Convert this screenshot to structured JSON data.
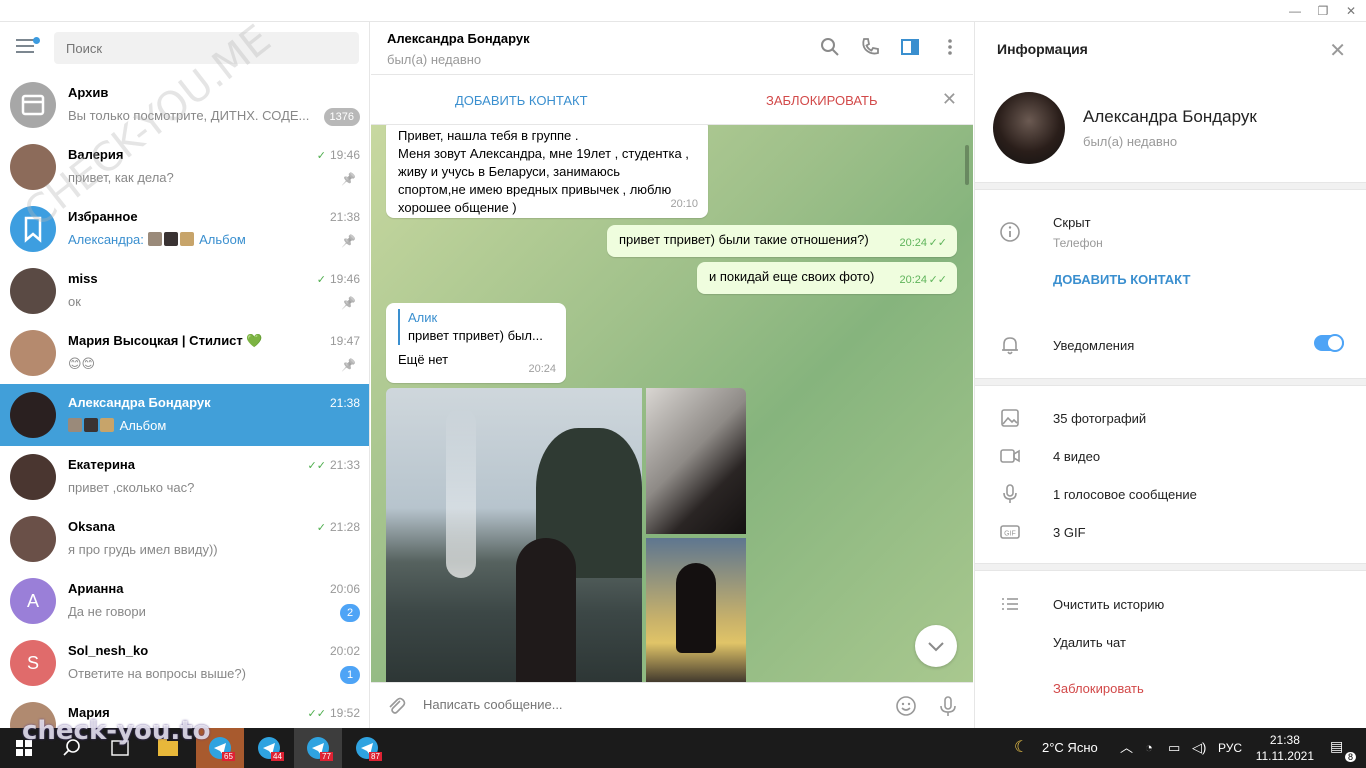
{
  "app": {
    "search_placeholder": "Поиск"
  },
  "chats": [
    {
      "name": "Архив",
      "preview": "Вы только посмотрите, ДИТНХ. СОДЕ...",
      "time": "",
      "badge": "1376",
      "badge_style": "grey",
      "check": "",
      "pinned": false,
      "avatar_color": "#a7a7a7",
      "avatar_text": "",
      "icon": "archive-icon"
    },
    {
      "name": "Валерия",
      "preview": "привет, как дела?",
      "time": "19:46",
      "check": "✓",
      "pinned": true,
      "avatar_color": "#8c6b5a",
      "avatar_text": ""
    },
    {
      "name": "Избранное",
      "preview_prefix": "Александра:",
      "preview": "Альбом",
      "time": "21:38",
      "check": "",
      "pinned": true,
      "avatar_color": "#3d9ee0",
      "avatar_text": "",
      "icon": "bookmark-icon"
    },
    {
      "name": "miss",
      "preview": "ок",
      "time": "19:46",
      "check": "✓",
      "pinned": true,
      "avatar_color": "#5a4a44",
      "avatar_text": ""
    },
    {
      "name": "Мария Высоцкая | Стилист 💚",
      "preview": "😊😊",
      "time": "19:47",
      "check": "",
      "pinned": true,
      "avatar_color": "#b58a6e",
      "avatar_text": ""
    },
    {
      "name": "Александра Бондарук",
      "preview": "Альбом",
      "time": "21:38",
      "check": "",
      "pinned": false,
      "active": true,
      "avatar_color": "#2a2020",
      "avatar_text": ""
    },
    {
      "name": "Екатерина",
      "preview": "привет ,сколько час?",
      "time": "21:33",
      "check": "✓✓",
      "pinned": false,
      "avatar_color": "#4a3630",
      "avatar_text": ""
    },
    {
      "name": "Oksana",
      "preview": "я про грудь имел ввиду))",
      "time": "21:28",
      "check": "✓",
      "pinned": false,
      "avatar_color": "#6a5048",
      "avatar_text": ""
    },
    {
      "name": "Арианна",
      "preview": "Да не говори",
      "time": "20:06",
      "check": "",
      "badge": "2",
      "pinned": false,
      "avatar_color": "#9a7fd8",
      "avatar_text": "А"
    },
    {
      "name": "Sol_nesh_ko",
      "preview": "Ответите на вопросы выше?)",
      "time": "20:02",
      "check": "",
      "badge": "1",
      "pinned": false,
      "avatar_color": "#e06b6b",
      "avatar_text": "S"
    },
    {
      "name": "Мария",
      "preview": "",
      "time": "19:52",
      "check": "✓✓",
      "pinned": false,
      "avatar_color": "#b08a70",
      "avatar_text": ""
    }
  ],
  "conversation": {
    "peer_name": "Александра Бондарук",
    "peer_status": "был(а) недавно",
    "add_contact": "ДОБАВИТЬ КОНТАКТ",
    "block": "ЗАБЛОКИРОВАТЬ",
    "messages": [
      {
        "dir": "in",
        "text": "Привет, нашла тебя в группе .\nМеня зовут Александра, мне 19лет , студентка ,\nживу и учусь в Беларуси, занимаюсь\nспортом,не имею вредных привычек , люблю\nхорошее общение )",
        "time": "20:10"
      },
      {
        "dir": "out",
        "text": "привет тпривет) были такие отношения?)",
        "time": "20:24",
        "ticks": "✓✓"
      },
      {
        "dir": "out",
        "text": "и покидай еще своих фото)",
        "time": "20:24",
        "ticks": "✓✓"
      },
      {
        "dir": "in",
        "reply_name": "Алик",
        "reply_text": "привет тпривет) был...",
        "text": "Ещё нет",
        "time": "20:24"
      }
    ],
    "compose_placeholder": "Написать сообщение..."
  },
  "info": {
    "title": "Информация",
    "name": "Александра Бондарук",
    "status": "был(а) недавно",
    "phone_value": "Скрыт",
    "phone_label": "Телефон",
    "add_contact": "ДОБАВИТЬ КОНТАКТ",
    "notifications": "Уведомления",
    "notifications_on": true,
    "media": [
      "35 фотографий",
      "4 видео",
      "1 голосовое сообщение",
      "3 GIF"
    ],
    "clear_history": "Очистить историю",
    "delete_chat": "Удалить чат",
    "block": "Заблокировать"
  },
  "taskbar": {
    "weather": "2°C  Ясно",
    "lang": "РУС",
    "time": "21:38",
    "date": "11.11.2021",
    "notif_count": "8",
    "tg_badges": [
      "65",
      "44",
      "77",
      "87"
    ]
  },
  "watermarks": [
    "CHECK-YOU.ME",
    "check-you.to"
  ],
  "colors": {
    "accent": "#419fd9",
    "danger": "#d24949",
    "out_bubble": "#effdde",
    "check": "#4fae4e"
  }
}
